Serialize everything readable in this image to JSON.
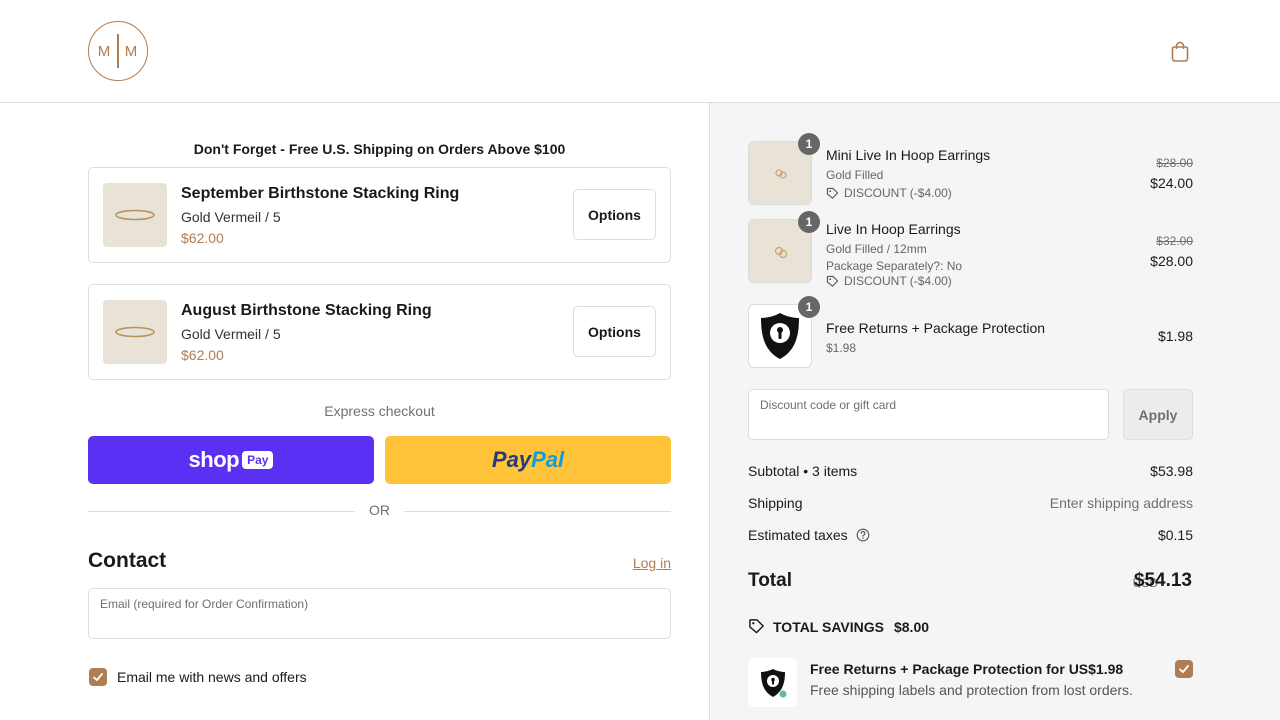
{
  "header": {
    "logo_text_left": "M",
    "logo_text_right": "M",
    "cart_icon": "shopping-bag-icon"
  },
  "upsell": {
    "banner": "Don't Forget - Free U.S. Shipping on Orders Above $100",
    "items": [
      {
        "name": "September Birthstone Stacking Ring",
        "variant": "Gold Vermeil / 5",
        "price": "$62.00",
        "button": "Options"
      },
      {
        "name": "August Birthstone Stacking Ring",
        "variant": "Gold Vermeil / 5",
        "price": "$62.00",
        "button": "Options"
      }
    ]
  },
  "express": {
    "label": "Express checkout",
    "shop_word": "shop",
    "shop_pill": "Pay",
    "paypal_part1": "Pay",
    "paypal_part2": "Pal",
    "or": "OR"
  },
  "contact": {
    "title": "Contact",
    "login": "Log in",
    "email_label": "Email (required for Order Confirmation)",
    "email_value": "",
    "newsletter_label": "Email me with news and offers",
    "newsletter_checked": true
  },
  "order": {
    "items": [
      {
        "qty": "1",
        "name": "Mini Live In Hoop Earrings",
        "sub1": "Gold Filled",
        "sub2": "",
        "discount": "DISCOUNT (-$4.00)",
        "old_price": "$28.00",
        "price": "$24.00"
      },
      {
        "qty": "1",
        "name": "Live In Hoop Earrings",
        "sub1": "Gold Filled / 12mm",
        "sub2": "Package Separately?: No",
        "discount": "DISCOUNT (-$4.00)",
        "old_price": "$32.00",
        "price": "$28.00"
      },
      {
        "qty": "1",
        "name": "Free Returns + Package Protection",
        "sub1": "$1.98",
        "sub2": "",
        "discount": "",
        "old_price": "",
        "price": "$1.98"
      }
    ],
    "discount_label": "Discount code or gift card",
    "discount_value": "",
    "apply": "Apply",
    "subtotal_label": "Subtotal • 3 items",
    "subtotal": "$53.98",
    "shipping_label": "Shipping",
    "shipping": "Enter shipping address",
    "taxes_label": "Estimated taxes",
    "taxes": "$0.15",
    "total_label": "Total",
    "currency": "USD",
    "total": "$54.13",
    "savings_label": "TOTAL SAVINGS",
    "savings": "$8.00",
    "protection_title": "Free Returns + Package Protection for US$1.98",
    "protection_desc": "Free shipping labels and protection from lost orders.",
    "protection_checked": true
  },
  "colors": {
    "accent": "#b07d52",
    "shop_pay": "#5a31f4",
    "paypal": "#ffc439"
  }
}
